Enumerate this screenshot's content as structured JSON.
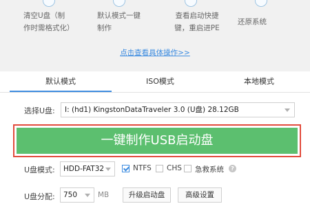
{
  "steps": {
    "items": [
      {
        "label": "清空U盘（制\n作时需格式化）"
      },
      {
        "label": "默认模式一键\n制作"
      },
      {
        "label": "查看启动快捷\n键，重启进PE"
      },
      {
        "label": "还原系统"
      }
    ],
    "link": "点击查看具体操作>>"
  },
  "tabs": [
    {
      "label": "默认模式",
      "active": true
    },
    {
      "label": "ISO模式",
      "active": false
    },
    {
      "label": "本地模式",
      "active": false
    }
  ],
  "disk": {
    "label": "选择U盘:",
    "value": "I: (hd1) KingstonDataTraveler 3.0 (U盘) 28.12GB"
  },
  "primary_button": "一键制作USB启动盘",
  "format": {
    "label": "U盘模式:",
    "value": "HDD-FAT32",
    "options": [
      {
        "label": "NTFS",
        "checked": true
      },
      {
        "label": "CHS",
        "checked": false
      },
      {
        "label": "急救系统",
        "checked": false
      }
    ]
  },
  "partition": {
    "label": "U盘分配:",
    "value": "750",
    "unit": "MB",
    "upgrade_button": "升级启动盘",
    "advanced_button": "高级设置"
  },
  "colors": {
    "accent": "#3d8be0",
    "primary_button": "#5cbf6f",
    "highlight_outline": "#e24b3c"
  }
}
